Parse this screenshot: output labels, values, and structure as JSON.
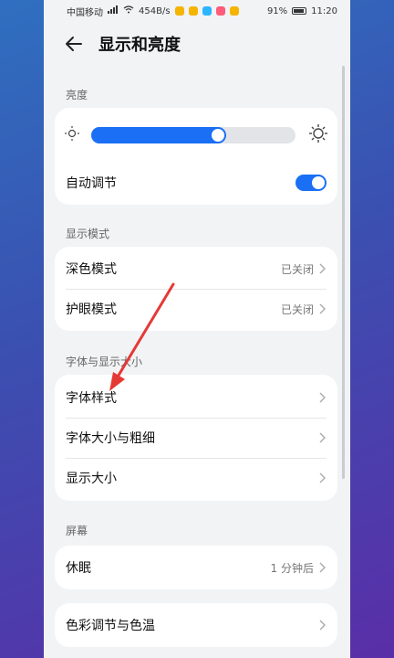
{
  "status_bar": {
    "carrier": "中国移动",
    "net_speed": "454B/s",
    "battery": "91%",
    "time": "11:20"
  },
  "header": {
    "title": "显示和亮度"
  },
  "brightness": {
    "section_label": "亮度",
    "level": 0.66,
    "auto_label": "自动调节",
    "auto_on": true
  },
  "display_mode": {
    "section_label": "显示模式",
    "items": [
      {
        "label": "深色模式",
        "value": "已关闭"
      },
      {
        "label": "护眼模式",
        "value": "已关闭"
      }
    ]
  },
  "font": {
    "section_label": "字体与显示大小",
    "items": [
      {
        "label": "字体样式"
      },
      {
        "label": "字体大小与粗细"
      },
      {
        "label": "显示大小"
      }
    ]
  },
  "screen": {
    "section_label": "屏幕",
    "items": [
      {
        "label": "休眠",
        "value": "1 分钟后"
      }
    ]
  },
  "color": {
    "items": [
      {
        "label": "色彩调节与色温"
      }
    ]
  },
  "colors": {
    "accent": "#1a6ff5",
    "arrow": "#e53935"
  }
}
